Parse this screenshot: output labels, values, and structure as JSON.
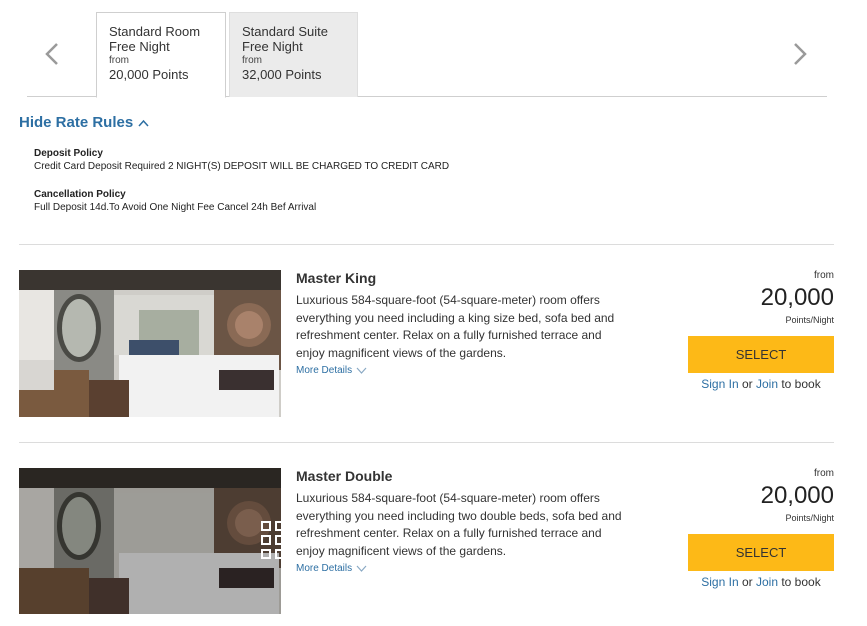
{
  "tabs": [
    {
      "line1": "Standard Room",
      "line2": "Free Night",
      "from": "from",
      "points": "20,000 Points",
      "active": true
    },
    {
      "line1": "Standard Suite",
      "line2": "Free Night",
      "from": "from",
      "points": "32,000 Points",
      "active": false
    }
  ],
  "nav": {
    "prev_icon": "chevron-left-icon",
    "next_icon": "chevron-right-icon"
  },
  "rate_rules": {
    "toggle_label": "Hide Rate Rules",
    "deposit_title": "Deposit Policy",
    "deposit_text": "Credit Card Deposit Required 2 NIGHT(S) DEPOSIT WILL BE CHARGED TO CREDIT CARD",
    "cancel_title": "Cancellation Policy",
    "cancel_text": "Full Deposit 14d.To Avoid One Night Fee Cancel 24h Bef Arrival"
  },
  "rooms": [
    {
      "title": "Master King",
      "desc": "Luxurious 584-square-foot (54-square-meter) room offers everything you need including a king size bed, sofa bed and refreshment center. Relax on a fully furnished terrace and enjoy magnificent views of the gardens.",
      "more": "More Details",
      "from": "from",
      "price": "20,000",
      "unit": "Points/Night",
      "select": "SELECT",
      "sign_in": "Sign In",
      "or": "or",
      "join": "Join",
      "to_book": "to book"
    },
    {
      "title": "Master Double",
      "desc": "Luxurious 584-square-foot (54-square-meter) room offers everything you need including two double beds, sofa bed and refreshment center. Relax on a fully furnished terrace and enjoy magnificent views of the gardens.",
      "more": "More Details",
      "from": "from",
      "price": "20,000",
      "unit": "Points/Night",
      "select": "SELECT",
      "sign_in": "Sign In",
      "or": "or",
      "join": "Join",
      "to_book": "to book"
    }
  ],
  "colors": {
    "accent": "#2d6fa3",
    "select": "#fdb917"
  }
}
